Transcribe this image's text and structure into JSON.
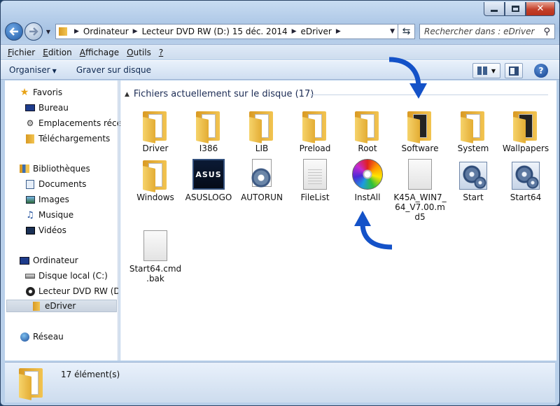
{
  "window": {
    "caption_buttons": [
      "minimize",
      "maximize",
      "close"
    ]
  },
  "address_bar": {
    "crumbs": [
      "Ordinateur",
      "Lecteur DVD RW (D:) 15 déc. 2014",
      "eDriver"
    ]
  },
  "search": {
    "placeholder": "Rechercher dans : eDriver"
  },
  "menu": [
    {
      "accel": "F",
      "rest": "ichier"
    },
    {
      "accel": "E",
      "rest": "dition"
    },
    {
      "accel": "A",
      "rest": "ffichage"
    },
    {
      "accel": "O",
      "rest": "utils"
    },
    {
      "accel": "?",
      "rest": ""
    }
  ],
  "toolbar": {
    "organize": "Organiser",
    "burn": "Graver sur disque"
  },
  "nav": {
    "favorites": "Favoris",
    "desktop": "Bureau",
    "recent": "Emplacements récents",
    "downloads": "Téléchargements",
    "libraries": "Bibliothèques",
    "documents": "Documents",
    "images": "Images",
    "music": "Musique",
    "videos": "Vidéos",
    "computer": "Ordinateur",
    "local_disk": "Disque local (C:)",
    "dvd": "Lecteur DVD RW (D:)",
    "edriver": "eDriver",
    "network": "Réseau"
  },
  "group_header": "Fichiers actuellement sur le disque (17)",
  "items": [
    {
      "label": "Driver",
      "type": "folder"
    },
    {
      "label": "I386",
      "type": "folder"
    },
    {
      "label": "LIB",
      "type": "folder"
    },
    {
      "label": "Preload",
      "type": "folder"
    },
    {
      "label": "Root",
      "type": "folder"
    },
    {
      "label": "Software",
      "type": "folder"
    },
    {
      "label": "System",
      "type": "folder"
    },
    {
      "label": "Wallpapers",
      "type": "folder"
    },
    {
      "label": "Windows",
      "type": "folder"
    },
    {
      "label": "ASUSLOGO",
      "type": "asus"
    },
    {
      "label": "AUTORUN",
      "type": "config"
    },
    {
      "label": "FileList",
      "type": "file"
    },
    {
      "label": "InstAll",
      "type": "cd"
    },
    {
      "label": "K45A_WIN7_64_V7.00.md5",
      "type": "file"
    },
    {
      "label": "Start",
      "type": "app"
    },
    {
      "label": "Start64",
      "type": "app"
    },
    {
      "label": "Start64.cmd.bak",
      "type": "file"
    }
  ],
  "asus_logo_text": "ASUS",
  "status": {
    "count": "17 élément(s)"
  },
  "colors": {
    "accent": "#1452c8",
    "folder": "#f2c451"
  }
}
